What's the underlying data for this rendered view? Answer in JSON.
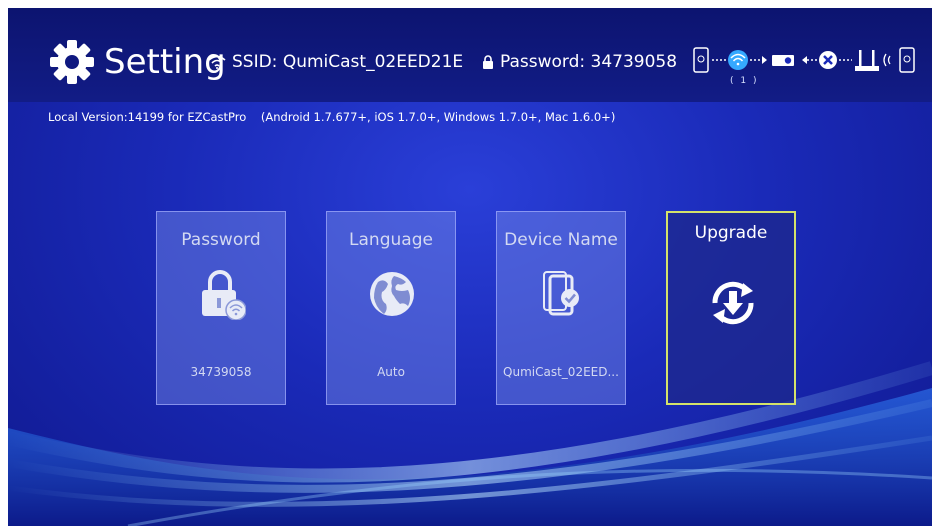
{
  "header": {
    "title": "Setting",
    "ssid_label": "SSID: QumiCast_02EED21E",
    "password_label": "Password: 34739058",
    "connection_count": "( 1 )"
  },
  "version_line": "Local Version:14199 for EZCastPro    (Android 1.7.677+, iOS 1.7.0+, Windows 1.7.0+, Mac 1.6.0+)",
  "cards": [
    {
      "label": "Password",
      "value": "34739058",
      "icon": "lock-wifi-icon"
    },
    {
      "label": "Language",
      "value": "Auto",
      "icon": "globe-icon"
    },
    {
      "label": "Device Name",
      "value": "QumiCast_02EED...",
      "icon": "phone-check-icon"
    },
    {
      "label": "Upgrade",
      "value": "",
      "icon": "upgrade-icon",
      "selected": true
    }
  ],
  "colors": {
    "background": "#1a2ab8",
    "selected_border": "#d4e26a",
    "card_text": "#d3d9f2"
  }
}
